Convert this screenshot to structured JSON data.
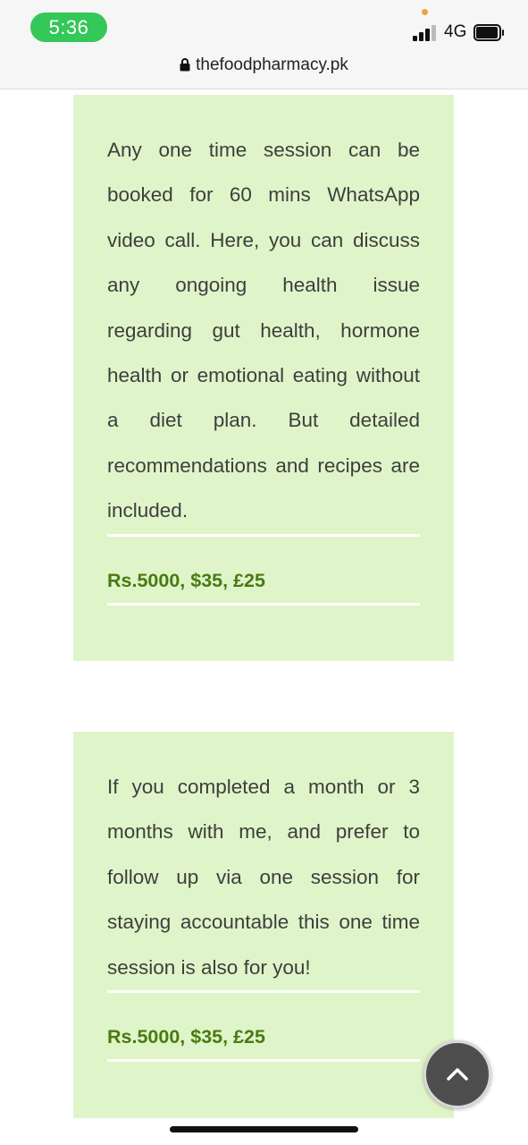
{
  "status_bar": {
    "time": "5:36",
    "network": "4G",
    "icons": [
      "signal-icon",
      "battery-icon"
    ]
  },
  "browser": {
    "url": "thefoodpharmacy.pk",
    "icons": [
      "lock-icon"
    ]
  },
  "cards": [
    {
      "description": "Any one time session can be booked for 60 mins WhatsApp video call. Here, you can discuss any ongoing health issue regarding gut health, hormone health or emotional eating without a diet plan. But detailed recommendations and recipes are included.",
      "price": "Rs.5000, $35, £25"
    },
    {
      "description": "If you completed a month or 3 months with me, and prefer to follow up via one session for staying accountable this one time session is also for you!",
      "price": "Rs.5000, $35, £25"
    }
  ],
  "scroll_top": {
    "icon": "chevron-up-icon"
  },
  "colors": {
    "card_background": "#dff5c9",
    "price_text": "#4a7a10",
    "time_pill": "#34c759"
  }
}
